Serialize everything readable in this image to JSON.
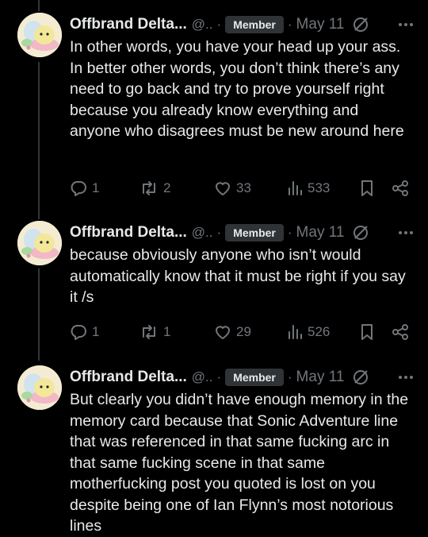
{
  "colors": {
    "background": "#000000",
    "text": "#e7e9ea",
    "muted": "#71767b",
    "badge_bg": "#2f3336"
  },
  "posts": [
    {
      "author": "Offbrand Delta...",
      "handle": "@..",
      "badge": "Member",
      "date": "May 11",
      "text": "In other words, you have your head up your ass. In better other words, you don’t think there’s any need to go back and try to prove yourself right because you already know everything and anyone who disagrees must be new around here",
      "replies": "1",
      "reposts": "2",
      "likes": "33",
      "views": "533"
    },
    {
      "author": "Offbrand Delta...",
      "handle": "@..",
      "badge": "Member",
      "date": "May 11",
      "text": "because obviously anyone who isn’t would automatically know that it must be right if you say it /s",
      "replies": "1",
      "reposts": "1",
      "likes": "29",
      "views": "526"
    },
    {
      "author": "Offbrand Delta...",
      "handle": "@..",
      "badge": "Member",
      "date": "May 11",
      "text": "But clearly you didn’t have enough memory in the memory card because that Sonic Adventure line that was referenced in that same fucking arc in that same fucking scene in that same motherfucking post you quoted is lost on you despite being one of Ian Flynn’s most notorious lines"
    }
  ],
  "icons": {
    "reply": "reply-icon",
    "repost": "repost-icon",
    "like": "heart-icon",
    "views": "views-icon",
    "bookmark": "bookmark-icon",
    "share": "share-icon",
    "grok": "grok-icon",
    "more": "more-icon"
  }
}
